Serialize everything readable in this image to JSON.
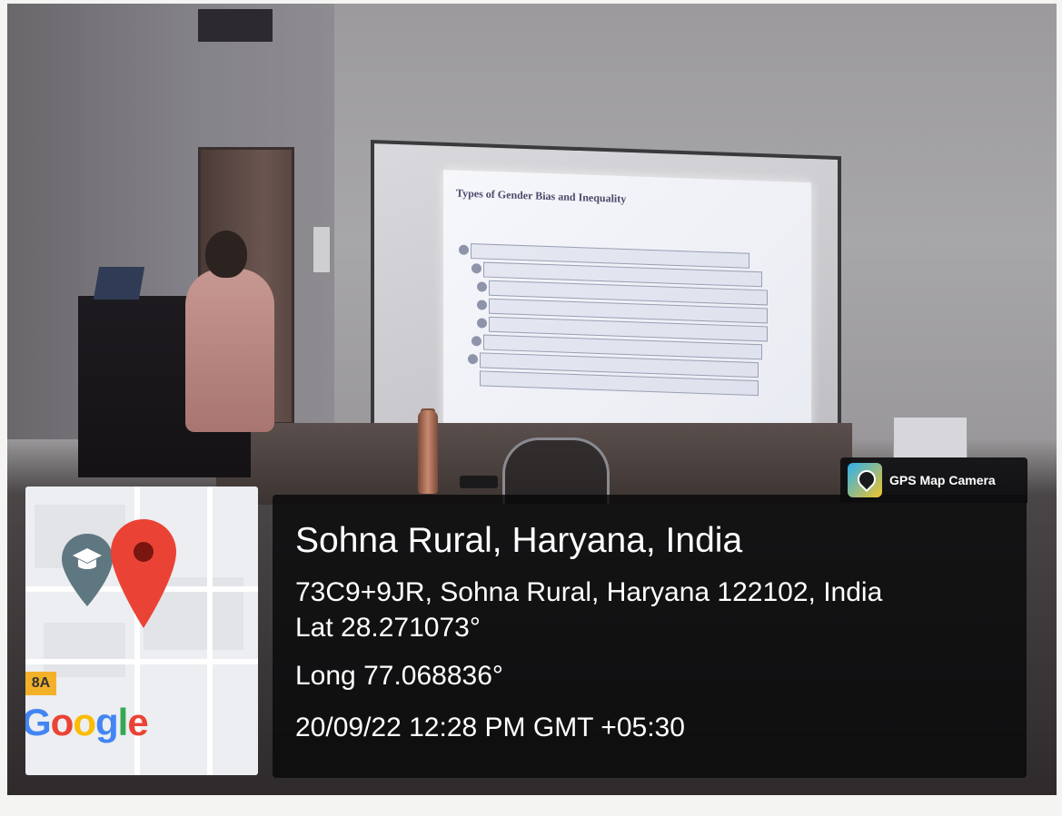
{
  "scene": {
    "slide": {
      "title": "Types of Gender Bias and Inequality",
      "bullet_rows": 8
    }
  },
  "overlay": {
    "app_badge_label": "GPS Map Camera",
    "app_badge_icon": "gps-map-camera-icon",
    "location_title": "Sohna Rural, Haryana, India",
    "address": "73C9+9JR, Sohna Rural, Haryana 122102, India",
    "latitude": "Lat 28.271073°",
    "longitude": "Long 77.068836°",
    "datetime": "20/09/22 12:28 PM GMT +05:30"
  },
  "map": {
    "route_badge": "8A",
    "logo_text": [
      "G",
      "o",
      "o",
      "g",
      "l",
      "e"
    ],
    "pins": [
      "education-pin-icon",
      "location-pin-icon"
    ],
    "colors": {
      "pin_red": "#ea4335",
      "pin_edu": "#5f7780",
      "route_badge": "#f3b12a"
    }
  }
}
